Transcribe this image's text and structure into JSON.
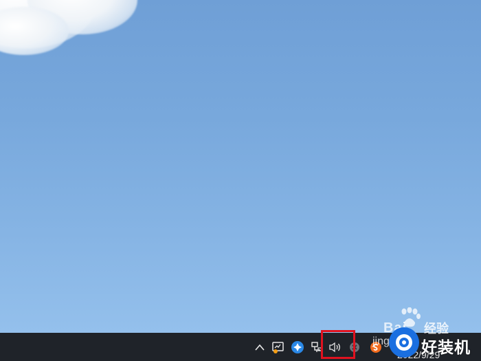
{
  "desktop": {
    "wallpaper": "blue sky with cloud"
  },
  "taskbar": {
    "tray_icons": [
      {
        "name": "chevron-up-icon"
      },
      {
        "name": "screen-icon"
      },
      {
        "name": "app-icon"
      },
      {
        "name": "network-icon"
      },
      {
        "name": "volume-icon"
      },
      {
        "name": "close-icon"
      },
      {
        "name": "sogou-input-icon"
      }
    ],
    "date": "2022/9/29"
  },
  "annotation": {
    "highlight_color": "#e0121f",
    "highlight_target": "volume-icon"
  },
  "watermark": {
    "baidu": "Bai",
    "jingyan": "经验",
    "jing_prefix": "jing",
    "logo_text": "好装机"
  }
}
